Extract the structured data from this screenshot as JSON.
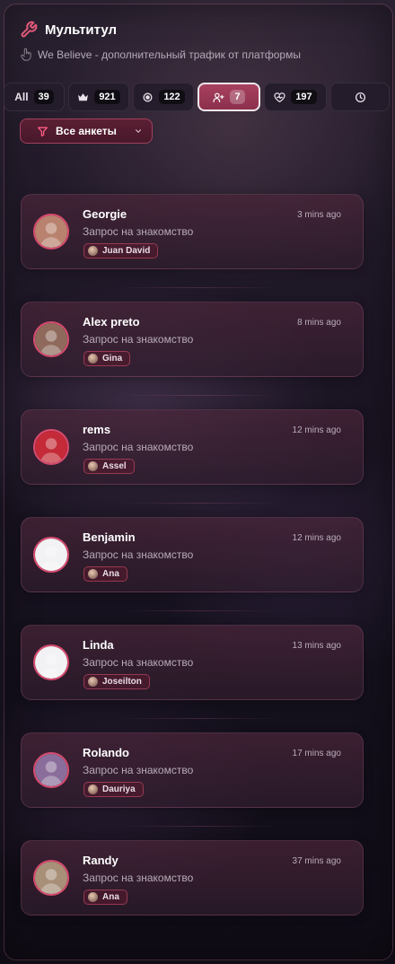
{
  "app": {
    "title": "Мультитул",
    "subtitle": "We Believe - дополнительный трафик от платформы"
  },
  "tabs": [
    {
      "key": "all",
      "label": "All",
      "count": "39",
      "icon": "none",
      "active": false
    },
    {
      "key": "vip",
      "label": "",
      "count": "921",
      "icon": "crown-icon",
      "active": false
    },
    {
      "key": "online",
      "label": "",
      "count": "122",
      "icon": "dot-icon",
      "active": false
    },
    {
      "key": "requests",
      "label": "",
      "count": "7",
      "icon": "user-plus-icon",
      "active": true
    },
    {
      "key": "likes",
      "label": "",
      "count": "197",
      "icon": "heart-pulse-icon",
      "active": false
    },
    {
      "key": "history",
      "label": "",
      "count": "",
      "icon": "clock-icon",
      "active": false
    }
  ],
  "filter": {
    "label": "Все анкеты",
    "icon": "filter-icon",
    "chevron": "chevron-down-icon"
  },
  "accent_color": "#a8415f",
  "requests": [
    {
      "name": "Georgie",
      "time": "3 mins ago",
      "text": "Запрос на знакомство",
      "profile": "Juan David",
      "avatar_color": "#b8826e"
    },
    {
      "name": "Alex preto",
      "time": "8 mins ago",
      "text": "Запрос на знакомство",
      "profile": "Gina",
      "avatar_color": "#8f6a5c"
    },
    {
      "name": "rems",
      "time": "12 mins ago",
      "text": "Запрос на знакомство",
      "profile": "Assel",
      "avatar_color": "#c42a37"
    },
    {
      "name": "Benjamin",
      "time": "12 mins ago",
      "text": "Запрос на знакомство",
      "profile": "Ana",
      "avatar_color": "#f2f2f4"
    },
    {
      "name": "Linda",
      "time": "13 mins ago",
      "text": "Запрос на знакомство",
      "profile": "Joseilton",
      "avatar_color": "#f2f2f4"
    },
    {
      "name": "Rolando",
      "time": "17 mins ago",
      "text": "Запрос на знакомство",
      "profile": "Dauriya",
      "avatar_color": "#8a6d9a"
    },
    {
      "name": "Randy",
      "time": "37 mins ago",
      "text": "Запрос на знакомство",
      "profile": "Ana",
      "avatar_color": "#a89078"
    }
  ]
}
